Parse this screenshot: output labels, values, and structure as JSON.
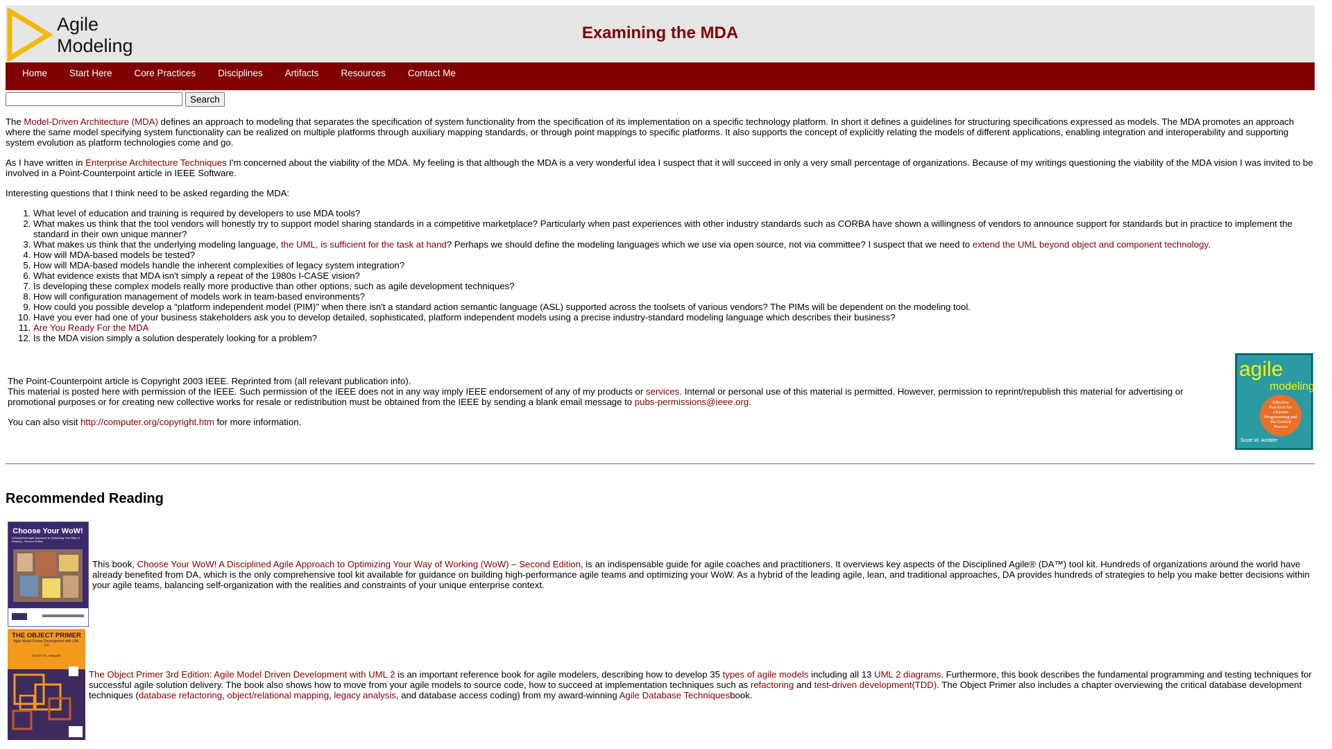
{
  "header": {
    "logo_line1": "Agile",
    "logo_line2": "Modeling",
    "title": "Examining the MDA"
  },
  "nav": [
    "Home",
    "Start Here",
    "Core Practices",
    "Disciplines",
    "Artifacts",
    "Resources",
    "Contact Me"
  ],
  "search": {
    "value": "",
    "button": "Search"
  },
  "intro": {
    "t1": "The ",
    "link": "Model-Driven Architecture (MDA)",
    "t2": " defines an approach to modeling that separates the specification of system functionality from the specification of its implementation on a specific technology platform. In short it defines a guidelines for structuring specifications expressed as models. The MDA promotes an approach where the same model specifying system functionality can be realized on multiple platforms through auxiliary mapping standards, or through point mappings to specific platforms. It also supports the concept of explicitly relating the models of different applications, enabling integration and interoperability and supporting system evolution as platform technologies come and go."
  },
  "para2": {
    "t1": "As I have written in ",
    "link": "Enterprise Architecture Techniques",
    "t2": " I'm concerned about the viability of the MDA. My feeling is that although the MDA is a very wonderful idea I suspect that it will succeed in only a very small percentage of organizations. Because of my writings questioning the viability of the MDA vision I was invited to be involved in a Point-Counterpoint article in IEEE Software."
  },
  "para3": "Interesting questions that I think need to be asked regarding the MDA:",
  "questions": {
    "q1": "What level of education and training is required by developers to use MDA tools?",
    "q2": "What makes us think that the tool vendors will honestly try to support model sharing standards in a competitive marketplace? Particularly when past experiences with other industry standards such as CORBA have shown a willingness of vendors to announce support for standards but in practice to implement the standard in their own unique manner?",
    "q3a": "What makes us think that the underlying modeling language, ",
    "q3link1": "the UML, is sufficient for the task at hand",
    "q3b": "? Perhaps we should define the modeling languages which we use via open source, not via committee? I suspect that we need to ",
    "q3link2": "extend the UML beyond object and component technology",
    "q3c": ".",
    "q4": "How will MDA-based models be tested?",
    "q5": "How will MDA-based models handle the inherent complexities of legacy system integration?",
    "q6": "What evidence exists that MDA isn't simply a repeat of the 1980s I-CASE vision?",
    "q7": "Is developing these complex models really more productive than other options, such as agile development techniques?",
    "q8": "How will configuration management of models work in team-based environments?",
    "q9": "How could you possible develop a \"platform independent model (PIM)\" when there isn't a standard action semantic language (ASL) supported across the toolsets of various vendors? The PIMs will be dependent on the modeling tool.",
    "q10": "Have you ever had one of your business stakeholders ask you to develop detailed, sophisticated, platform independent models using a precise industry-standard modeling language which describes their business?",
    "q11link": "Are You Ready For the MDA",
    "q12": "Is the MDA vision simply a solution desperately looking for a problem?"
  },
  "copyright": {
    "line1": "The Point-Counterpoint article is Copyright 2003 IEEE. Reprinted from (all relevant publication info).",
    "line2a": "This material is posted here with permission of the IEEE. Such permission of the IEEE does not in any way imply IEEE endorsement of any of my products or ",
    "services_link": "services",
    "line2b": ". Internal or personal use of this material is permitted. However, permission to reprint/republish this material for advertising or promotional purposes or for creating new collective works for resale or redistribution must be obtained from the IEEE by sending a blank email message to ",
    "email_link": "pubs-permissions@ieee.org",
    "line2c": ".",
    "visit_a": "You can also visit ",
    "visit_link": "http://computer.org/copyright.htm",
    "visit_b": " for more information."
  },
  "book_agile": {
    "title1": "agile",
    "title2": "modeling",
    "subtitle": "Effective Practices for eXtreme Programming and the Unified Process",
    "author": "Scott W. Ambler"
  },
  "recommended": {
    "heading": "Recommended Reading",
    "book1": {
      "cover_title": "Choose Your WoW!",
      "cover_sub": "A Disciplined Agile Approach to Optimizing Your Way of Working - Second Edition",
      "t1": "This book, ",
      "link": "Choose Your WoW! A Disciplined Agile Approach to Optimizing Your Way of Working (WoW) – Second Edition",
      "t2": ", is an indispensable guide for agile coaches and practitioners. It overviews key aspects of the Disciplined Agile® (DA™) tool kit. Hundreds of organizations around the world have already benefited from DA, which is the only comprehensive tool kit available for guidance on building high-performance agile teams and optimizing your WoW. As a hybrid of the leading agile, lean, and traditional approaches, DA provides hundreds of strategies to help you make better decisions within your agile teams, balancing self-organization with the realities and constraints of your unique enterprise context."
    },
    "book2": {
      "cover_title": "THE OBJECT PRIMER",
      "cover_sub": "Agile Model-Driven Development with UML 2.0",
      "cover_author": "SCOTT W. AMBLER",
      "link1": "The Object Primer 3rd Edition: Agile Model Driven Development with UML 2",
      "t1": " is an important reference book for agile modelers, describing how to develop 35 ",
      "link2": "types of agile models",
      "t2": " including all 13 ",
      "link3": "UML 2 diagrams",
      "t3": ". Furthermore, this book describes the fundamental programming and testing techniques for successful agile solution delivery. The book also shows how to move from your agile models to source code, how to succeed at implementation techniques such as ",
      "link4": "refactoring",
      "t4": " and ",
      "link5": "test-driven development(TDD)",
      "t5": ". The Object Primer also includes a chapter overviewing the critical database development techniques (",
      "link6": "database refactoring",
      "t6": ", ",
      "link7": "object/relational mapping",
      "t7": ", ",
      "link8": "legacy analysis",
      "t8": ", and database access coding) from my award-winning ",
      "link9": "Agile Database Techniques",
      "t9": "book."
    }
  },
  "colors": {
    "brand": "#800000",
    "header_bg": "#e6e6e6",
    "logo_yellow": "#f5b800"
  }
}
